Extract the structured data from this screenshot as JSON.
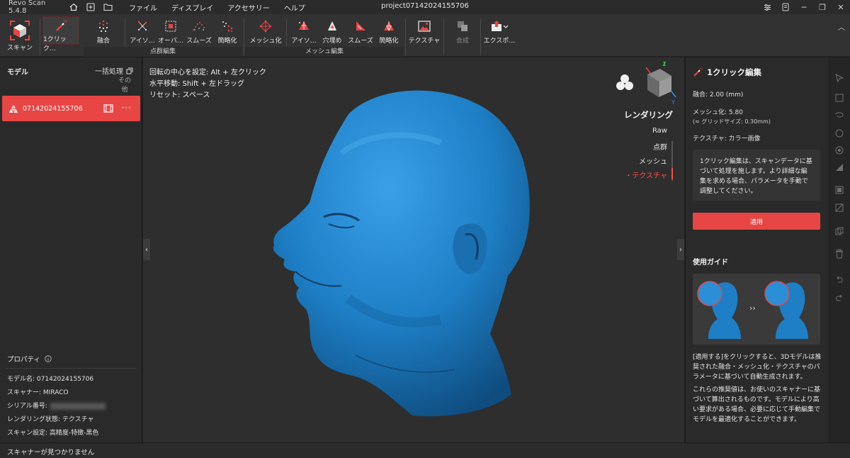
{
  "app": {
    "title": "Revo Scan 5.4.8",
    "project_title": "project07142024155706"
  },
  "menu": [
    "ファイル",
    "ディスプレイ",
    "アクセサリー",
    "ヘルプ"
  ],
  "toolbar": {
    "scan": "スキャン",
    "one_click": "1クリック…",
    "fuse": "融合",
    "isolate": "アイソ…",
    "overlap": "オーバ…",
    "smooth_pc": "スムーズ",
    "simplify_pc": "簡略化",
    "group_pointcloud": "点群編集",
    "meshing": "メッシュ化",
    "isolate_mesh": "アイソ…",
    "fill_holes": "穴埋め",
    "smooth_mesh": "スムーズ",
    "simplify_mesh": "簡略化",
    "group_mesh": "メッシュ編集",
    "texture": "テクスチャ",
    "merge": "合成",
    "export": "エクスポ…"
  },
  "left_panel": {
    "title": "モデル",
    "batch": "一括処理",
    "other": "その他",
    "model_name": "07142024155706",
    "properties_title": "プロパティ",
    "props": [
      {
        "label": "モデル名:",
        "value": "07142024155706"
      },
      {
        "label": "スキャナー:",
        "value": "MIRACO"
      },
      {
        "label": "シリアル番号:",
        "value": ""
      },
      {
        "label": "レンダリング状態:",
        "value": "テクスチャ"
      },
      {
        "label": "スキャン設定:",
        "value": "高精度-特徴-黒色"
      }
    ]
  },
  "viewport": {
    "hints": [
      "回転の中心を設定: Alt + 左クリック",
      "水平移動: Shift + 左ドラッグ",
      "リセット: スペース"
    ],
    "rendering_title": "レンダリング",
    "render_options": [
      "Raw",
      "点群",
      "メッシュ",
      "・テクスチャ"
    ],
    "active_render_index": 3
  },
  "right_panel": {
    "title": "1クリック編集",
    "fusion": "融合: 2.00 (mm)",
    "meshing": "メッシュ化: 5.80",
    "grid": "(≈ グリッドサイズ: 0.30mm)",
    "texture": "テクスチャ: カラー画像",
    "description": "1クリック編集は、スキャンデータに基づいて処理を施します。より詳細な編集を求める場合、パラメータを手動で調整してください。",
    "apply": "適用",
    "guide_title": "使用ガイド",
    "guide_text1": "[適用する]をクリックすると、3Dモデルは推奨された融合・メッシュ化・テクスチャのパラメータに基づいて自動生成されます。",
    "guide_text2": "これらの推奨値は、お使いのスキャナーに基づいて算出されるものです。モデルにより高い要求がある場合、必要に応じて手動編集でモデルを最適化することができます。"
  },
  "status": {
    "text": "スキャナーが見つかりません"
  },
  "colors": {
    "accent": "#e84545",
    "model": "#1e7fc6"
  }
}
